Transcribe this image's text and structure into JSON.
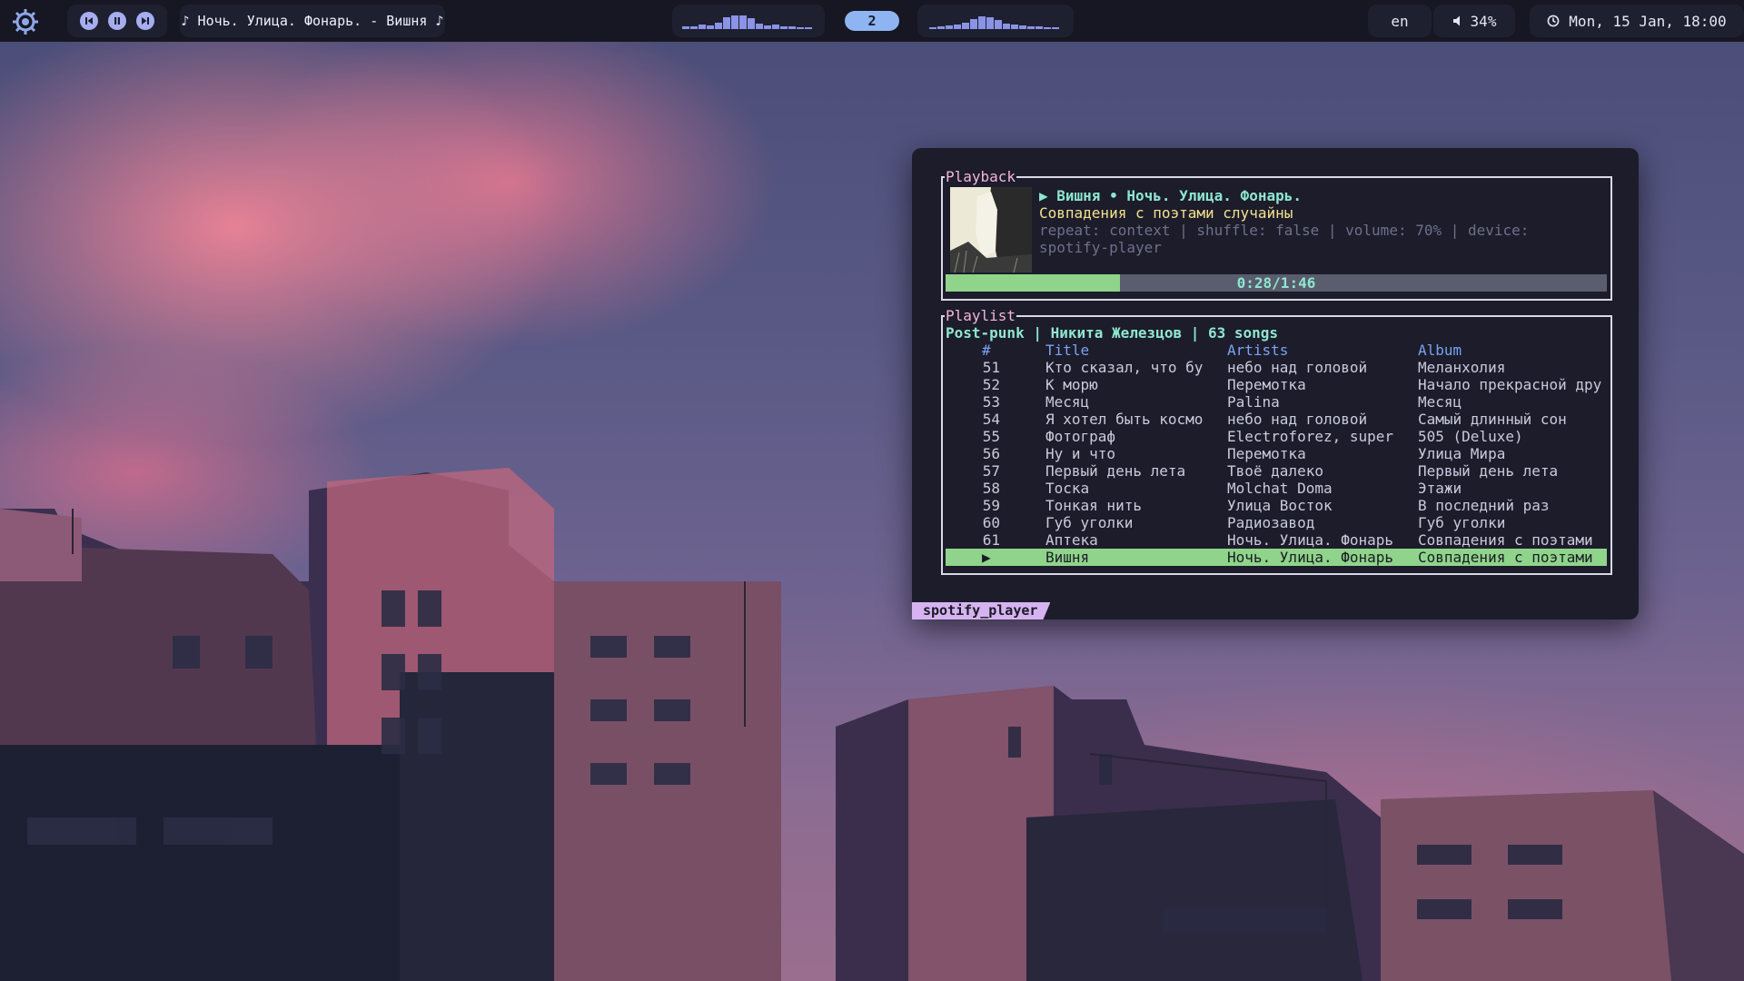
{
  "topbar": {
    "media": {
      "prev_icon": "skip-previous-icon",
      "pause_icon": "pause-icon",
      "next_icon": "skip-next-icon"
    },
    "now_playing": "♪ Ночь. Улица. Фонарь. - Вишня ♪",
    "workspace": "2",
    "language": "en",
    "volume": "34%",
    "clock": "Mon, 15 Jan, 18:00",
    "accent": "#a6aef0",
    "workspace_color": "#8fb4f2"
  },
  "player": {
    "window_tag": "spotify_player",
    "playback": {
      "box_title": "Playback",
      "title": "▶ Вишня • Ночь. Улица. Фонарь.",
      "album": "Совпадения с поэтами случайны",
      "meta": "repeat: context | shuffle: false | volume: 70% | device: spotify-player",
      "progress_text": "0:28/1:46",
      "progress": 0.264
    },
    "playlist": {
      "box_title": "Playlist",
      "header": "Post-punk | Никита Железцов | 63 songs",
      "columns": {
        "num": "#",
        "title": "Title",
        "artists": "Artists",
        "album": "Album"
      },
      "rows": [
        {
          "num": "51",
          "title": "Кто сказал, что бу",
          "artists": "небо над головой",
          "album": "Меланхолия"
        },
        {
          "num": "52",
          "title": "К морю",
          "artists": "Перемотка",
          "album": "Начало прекрасной дру"
        },
        {
          "num": "53",
          "title": "Месяц",
          "artists": "Palina",
          "album": "Месяц"
        },
        {
          "num": "54",
          "title": "Я хотел быть космо",
          "artists": "небо над головой",
          "album": "Самый длинный сон"
        },
        {
          "num": "55",
          "title": "Фотограф",
          "artists": "Electroforez, super",
          "album": "505 (Deluxe)"
        },
        {
          "num": "56",
          "title": "Ну и что",
          "artists": "Перемотка",
          "album": "Улица Мира"
        },
        {
          "num": "57",
          "title": "Первый день лета",
          "artists": "Твоё далеко",
          "album": "Первый день лета"
        },
        {
          "num": "58",
          "title": "Тоска",
          "artists": "Molchat Doma",
          "album": "Этажи"
        },
        {
          "num": "59",
          "title": "Тонкая нить",
          "artists": "Улица Восток",
          "album": "В последний раз"
        },
        {
          "num": "60",
          "title": "Губ уголки",
          "artists": "Радиозавод",
          "album": "Губ уголки"
        },
        {
          "num": "61",
          "title": "Аптека",
          "artists": "Ночь. Улица. Фонарь",
          "album": "Совпадения с поэтами"
        },
        {
          "num": "▶",
          "title": "Вишня",
          "artists": "Ночь. Улица. Фонарь",
          "album": "Совпадения с поэтами",
          "active": true
        }
      ]
    }
  }
}
